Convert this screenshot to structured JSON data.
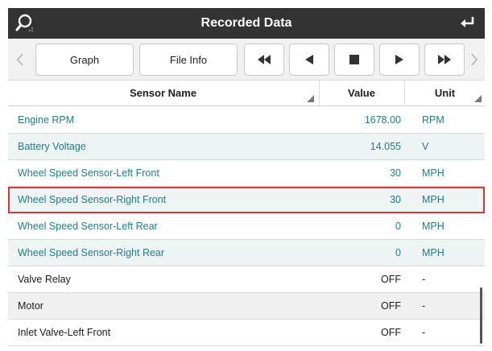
{
  "header": {
    "title": "Recorded Data",
    "search_icon": "search-icon",
    "back_icon": "return-arrow-icon"
  },
  "toolbar": {
    "graph_label": "Graph",
    "file_info_label": "File Info",
    "icons": [
      "rewind-icon",
      "step-back-icon",
      "stop-icon",
      "play-icon",
      "fast-forward-icon"
    ]
  },
  "table": {
    "columns": {
      "name": "Sensor Name",
      "value": "Value",
      "unit": "Unit"
    },
    "rows": [
      {
        "name": "Engine RPM",
        "value": "1678.00",
        "unit": "RPM",
        "style": "teal",
        "bg": "#ffffff",
        "highlight": false
      },
      {
        "name": "Battery Voltage",
        "value": "14.055",
        "unit": "V",
        "style": "teal",
        "bg": "#eef3f4",
        "highlight": false
      },
      {
        "name": "Wheel Speed Sensor-Left Front",
        "value": "30",
        "unit": "MPH",
        "style": "teal",
        "bg": "#ffffff",
        "highlight": false
      },
      {
        "name": "Wheel Speed Sensor-Right Front",
        "value": "30",
        "unit": "MPH",
        "style": "teal",
        "bg": "#eef3f4",
        "highlight": true
      },
      {
        "name": "Wheel Speed Sensor-Left Rear",
        "value": "0",
        "unit": "MPH",
        "style": "teal",
        "bg": "#ffffff",
        "highlight": false
      },
      {
        "name": "Wheel Speed Sensor-Right Rear",
        "value": "0",
        "unit": "MPH",
        "style": "teal",
        "bg": "#eef3f4",
        "highlight": false
      },
      {
        "name": "Valve Relay",
        "value": "OFF",
        "unit": "-",
        "style": "dark",
        "bg": "#ffffff",
        "highlight": false
      },
      {
        "name": "Motor",
        "value": "OFF",
        "unit": "-",
        "style": "dark",
        "bg": "#f0f0f0",
        "highlight": false
      },
      {
        "name": "Inlet Valve-Left Front",
        "value": "OFF",
        "unit": "-",
        "style": "dark",
        "bg": "#ffffff",
        "highlight": false
      }
    ]
  },
  "colors": {
    "header_bg": "#333333",
    "teal_text": "#1d7f8d",
    "highlight_border": "#d9343a"
  }
}
